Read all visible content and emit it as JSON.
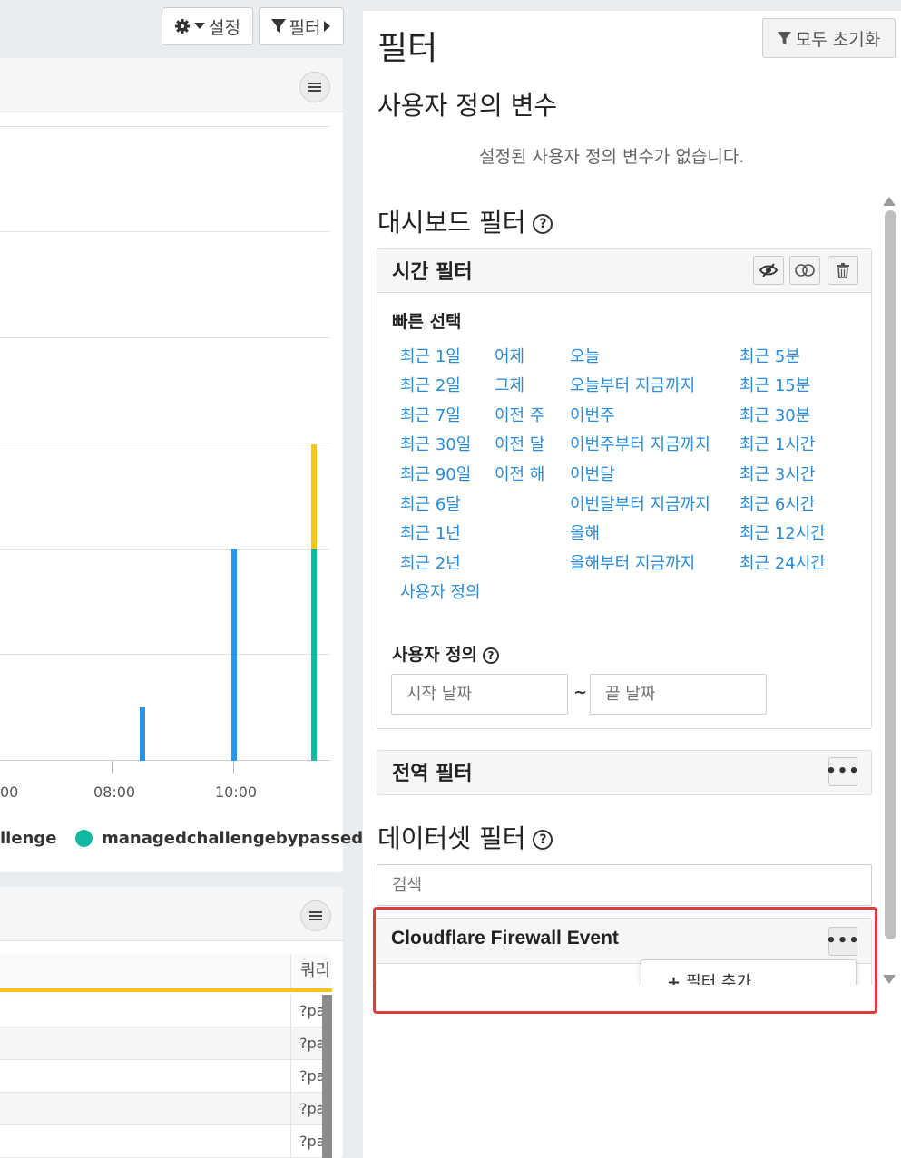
{
  "toolbar": {
    "settings_label": "설정",
    "filter_label": "필터"
  },
  "chart": {
    "x_ticks": [
      "00",
      "08:00",
      "10:00"
    ],
    "legend": [
      "llenge",
      "managedchallengebypassed"
    ],
    "colors": {
      "blue": "#2196f3",
      "yellow": "#f5c518",
      "teal": "#14b8a0"
    }
  },
  "table": {
    "column_header": "쿼리",
    "rows": [
      "?pa",
      "?pa",
      "?pa",
      "?pa",
      "?pa"
    ]
  },
  "filter_panel": {
    "title": "필터",
    "reset_all_label": "모두 초기화",
    "user_vars": {
      "heading": "사용자 정의 변수",
      "empty_message": "설정된 사용자 정의 변수가 없습니다."
    },
    "dashboard_filter": {
      "heading": "대시보드 필터",
      "help": "?"
    },
    "time_filter": {
      "title": "시간 필터",
      "quick_select_label": "빠른 선택",
      "columns": [
        [
          "최근 1일",
          "최근 2일",
          "최근 7일",
          "최근 30일",
          "최근 90일",
          "최근 6달",
          "최근 1년",
          "최근 2년",
          "사용자 정의"
        ],
        [
          "어제",
          "그제",
          "이전 주",
          "이전 달",
          "이전 해"
        ],
        [
          "오늘",
          "오늘부터 지금까지",
          "이번주",
          "이번주부터 지금까지",
          "이번달",
          "이번달부터 지금까지",
          "올해",
          "올해부터 지금까지"
        ],
        [
          "최근 5분",
          "최근 15분",
          "최근 30분",
          "최근 1시간",
          "최근 3시간",
          "최근 6시간",
          "최근 12시간",
          "최근 24시간"
        ]
      ],
      "custom_label": "사용자 정의",
      "start_placeholder": "시작 날짜",
      "range_sep": "~",
      "end_placeholder": "끝 날짜"
    },
    "global_filter": {
      "title": "전역 필터"
    },
    "dataset_filter": {
      "heading": "데이터셋 필터",
      "search_placeholder": "검색",
      "dataset_name": "Cloudflare Firewall Event",
      "add_filter_label": "필터 추가"
    },
    "highlight_color": "#e03a3e"
  }
}
